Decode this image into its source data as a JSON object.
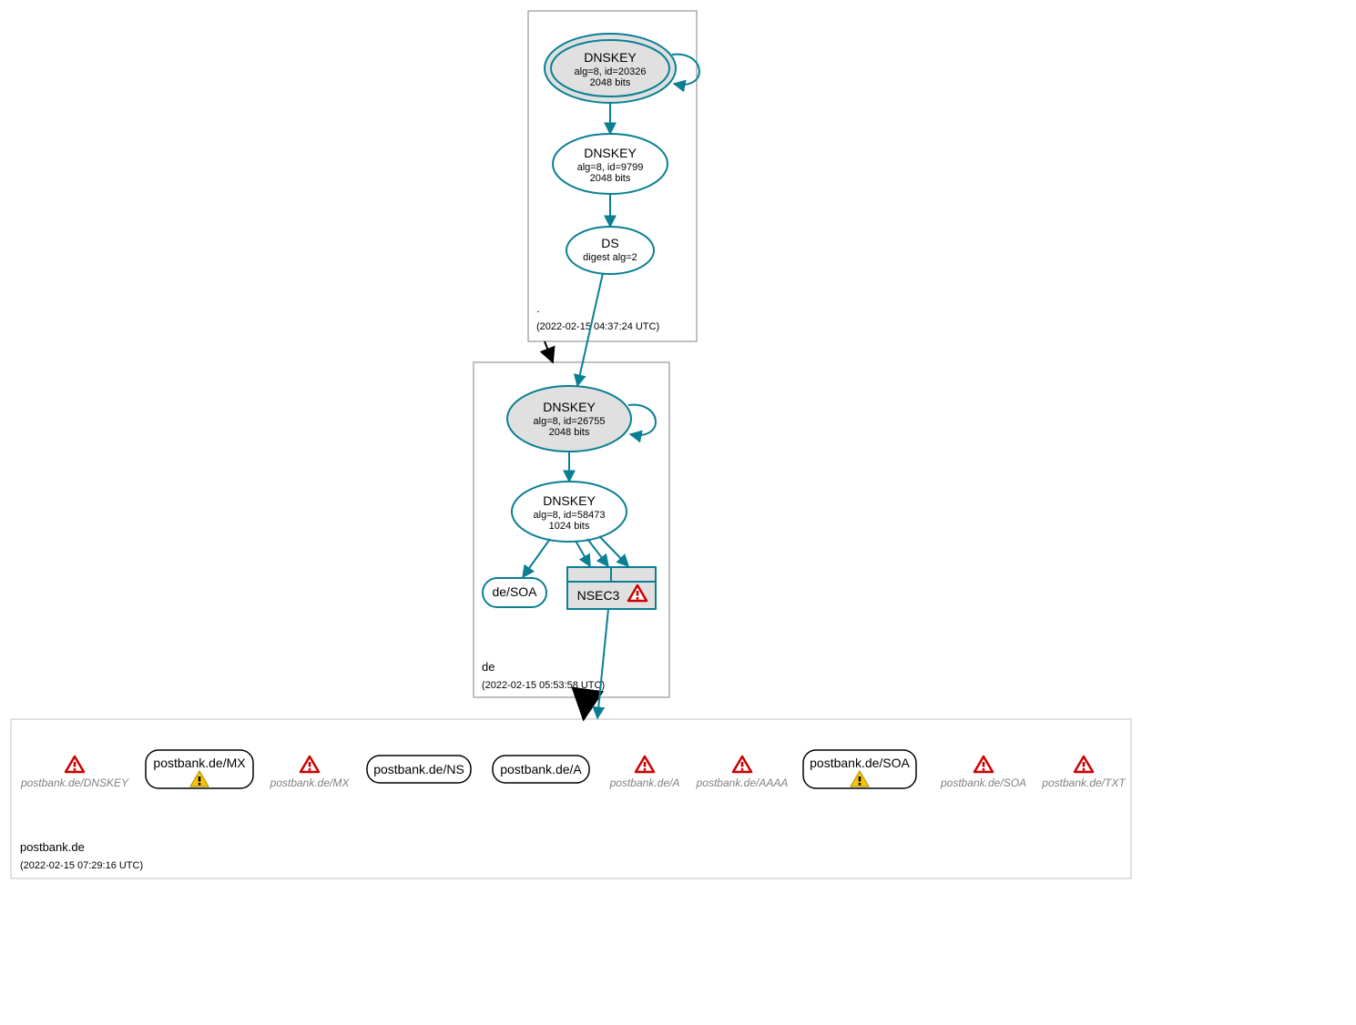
{
  "diagram_type": "DNSSEC authentication graph",
  "colors": {
    "teal": "#0a7f94",
    "node_fill": "#e0e0e0",
    "grey": "#808080",
    "light_grey": "#c0c0c0"
  },
  "zones": {
    "root": {
      "label": ".",
      "timestamp": "(2022-02-15 04:37:24 UTC)",
      "nodes": {
        "ksk": {
          "title": "DNSKEY",
          "line1": "alg=8, id=20326",
          "line2": "2048 bits",
          "style": "double-ellipse-grey"
        },
        "zsk": {
          "title": "DNSKEY",
          "line1": "alg=8, id=9799",
          "line2": "2048 bits",
          "style": "ellipse-white"
        },
        "ds": {
          "title": "DS",
          "line1": "digest alg=2",
          "style": "ellipse-white-small"
        }
      }
    },
    "de": {
      "label": "de",
      "timestamp": "(2022-02-15 05:53:58 UTC)",
      "nodes": {
        "ksk": {
          "title": "DNSKEY",
          "line1": "alg=8, id=26755",
          "line2": "2048 bits",
          "style": "ellipse-grey"
        },
        "zsk": {
          "title": "DNSKEY",
          "line1": "alg=8, id=58473",
          "line2": "1024 bits",
          "style": "ellipse-white"
        },
        "soa": {
          "title": "de/SOA",
          "style": "rr-white"
        },
        "nsec": {
          "title": "NSEC3",
          "style": "nsec-box",
          "status": "error"
        }
      }
    },
    "target": {
      "label": "postbank.de",
      "timestamp": "(2022-02-15 07:29:16 UTC)",
      "nodes": [
        {
          "title": "postbank.de/DNSKEY",
          "style": "phantom",
          "status": "error"
        },
        {
          "title": "postbank.de/MX",
          "style": "rr-black",
          "status": "warning"
        },
        {
          "title": "postbank.de/MX",
          "style": "phantom",
          "status": "error"
        },
        {
          "title": "postbank.de/NS",
          "style": "rr-black"
        },
        {
          "title": "postbank.de/A",
          "style": "rr-black"
        },
        {
          "title": "postbank.de/A",
          "style": "phantom",
          "status": "error"
        },
        {
          "title": "postbank.de/AAAA",
          "style": "phantom",
          "status": "error"
        },
        {
          "title": "postbank.de/SOA",
          "style": "rr-black",
          "status": "warning"
        },
        {
          "title": "postbank.de/SOA",
          "style": "phantom",
          "status": "error"
        },
        {
          "title": "postbank.de/TXT",
          "style": "phantom",
          "status": "error"
        }
      ]
    }
  },
  "edges": [
    {
      "from": "root.ksk",
      "to": "root.ksk",
      "kind": "self"
    },
    {
      "from": "root.ksk",
      "to": "root.zsk"
    },
    {
      "from": "root.zsk",
      "to": "root.ds"
    },
    {
      "from": "root.ds",
      "to": "de.ksk"
    },
    {
      "from": "root",
      "to": "de",
      "kind": "zone-arrow"
    },
    {
      "from": "de.ksk",
      "to": "de.ksk",
      "kind": "self"
    },
    {
      "from": "de.ksk",
      "to": "de.zsk"
    },
    {
      "from": "de.zsk",
      "to": "de.soa"
    },
    {
      "from": "de.zsk",
      "to": "de.nsec",
      "count": 3
    },
    {
      "from": "de.nsec",
      "to": "target"
    },
    {
      "from": "de",
      "to": "target",
      "kind": "zone-arrow"
    }
  ],
  "icons": {
    "error": "red-hollow-triangle-exclaim",
    "warning": "yellow-solid-triangle-exclaim"
  }
}
